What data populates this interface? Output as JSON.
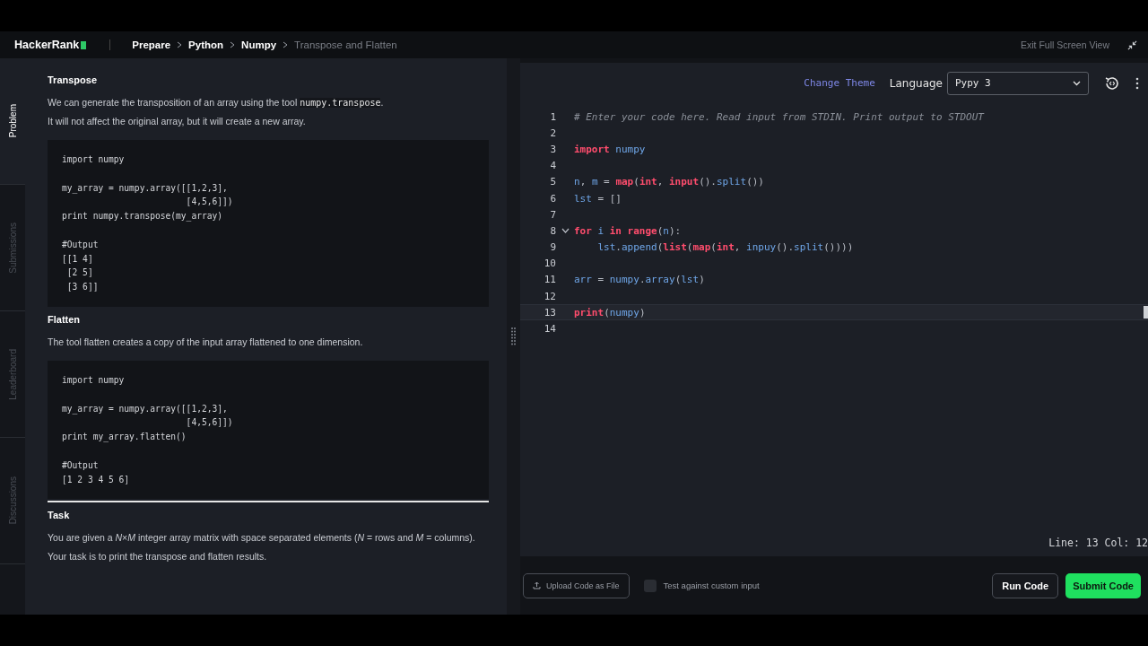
{
  "header": {
    "logo": "HackerRank",
    "breadcrumbs": [
      {
        "label": "Prepare",
        "current": false
      },
      {
        "label": "Python",
        "current": false
      },
      {
        "label": "Numpy",
        "current": false
      },
      {
        "label": "Transpose and Flatten",
        "current": true
      }
    ],
    "exit_label": "Exit Full Screen View"
  },
  "side_tabs": [
    {
      "label": "Problem",
      "selected": true
    },
    {
      "label": "Submissions",
      "selected": false
    },
    {
      "label": "Leaderboard",
      "selected": false
    },
    {
      "label": "Discussions",
      "selected": false
    }
  ],
  "problem": [
    {
      "kind": "heading",
      "text": "Transpose"
    },
    {
      "kind": "paragraph",
      "parts": [
        {
          "kind": "text",
          "text": "We can generate the transposition of an array using the tool "
        },
        {
          "kind": "code",
          "text": "numpy.transpose"
        },
        {
          "kind": "text",
          "text": "."
        }
      ]
    },
    {
      "kind": "paragraph",
      "parts": [
        {
          "kind": "text",
          "text": "It will not affect the original array, but it will create a new array."
        }
      ]
    },
    {
      "kind": "code",
      "text": "import numpy\n\nmy_array = numpy.array([[1,2,3],\n                        [4,5,6]])\nprint numpy.transpose(my_array)\n\n#Output\n[[1 4]\n [2 5]\n [3 6]]"
    },
    {
      "kind": "heading",
      "text": "Flatten"
    },
    {
      "kind": "paragraph",
      "parts": [
        {
          "kind": "text",
          "text": "The tool flatten creates a copy of the input array flattened to one dimension."
        }
      ]
    },
    {
      "kind": "code",
      "text": "import numpy\n\nmy_array = numpy.array([[1,2,3],\n                        [4,5,6]])\nprint my_array.flatten()\n\n#Output\n[1 2 3 4 5 6]"
    },
    {
      "kind": "rule"
    },
    {
      "kind": "heading",
      "text": "Task"
    },
    {
      "kind": "paragraph",
      "parts": [
        {
          "kind": "text",
          "text": "You are given a *N*×*M* integer array matrix with space separated elements (*N* = rows and *M* = columns)."
        }
      ]
    },
    {
      "kind": "paragraph",
      "parts": [
        {
          "kind": "text",
          "text": "Your task is to print the transpose and flatten results."
        }
      ]
    }
  ],
  "editor": {
    "change_theme": "Change Theme",
    "language_label": "Language",
    "language": "Pypy 3",
    "lines": [
      {
        "number": "1",
        "current": false,
        "tokens": [
          {
            "kind": "comment",
            "text": "# Enter your code here. Read input from STDIN. Print output to STDOUT"
          }
        ]
      },
      {
        "number": "2",
        "current": false
      },
      {
        "number": "3",
        "current": false,
        "tokens": [
          {
            "kind": "keyword",
            "text": "import"
          },
          {
            "kind": "name",
            "text": " numpy"
          }
        ]
      },
      {
        "number": "4",
        "current": false
      },
      {
        "number": "5",
        "current": false,
        "tokens": [
          {
            "kind": "name",
            "text": "n"
          },
          {
            "kind": "plain",
            "text": ", "
          },
          {
            "kind": "name",
            "text": "m"
          },
          {
            "kind": "plain",
            "text": " = "
          },
          {
            "kind": "keyword",
            "text": "map"
          },
          {
            "kind": "plain",
            "text": "("
          },
          {
            "kind": "keyword",
            "text": "int"
          },
          {
            "kind": "plain",
            "text": ", "
          },
          {
            "kind": "keyword",
            "text": "input"
          },
          {
            "kind": "plain",
            "text": "()."
          },
          {
            "kind": "name",
            "text": "split"
          },
          {
            "kind": "plain",
            "text": "())"
          }
        ]
      },
      {
        "number": "6",
        "current": false,
        "tokens": [
          {
            "kind": "name",
            "text": "lst"
          },
          {
            "kind": "plain",
            "text": " = []"
          }
        ]
      },
      {
        "number": "7",
        "current": false
      },
      {
        "number": "8",
        "current": false,
        "fold": true,
        "tokens": [
          {
            "kind": "keyword",
            "text": "for"
          },
          {
            "kind": "name",
            "text": " i "
          },
          {
            "kind": "keyword",
            "text": "in range"
          },
          {
            "kind": "plain",
            "text": "("
          },
          {
            "kind": "name",
            "text": "n"
          },
          {
            "kind": "plain",
            "text": "):"
          }
        ]
      },
      {
        "number": "9",
        "current": false,
        "tokens": [
          {
            "kind": "name",
            "text": "    lst"
          },
          {
            "kind": "plain",
            "text": "."
          },
          {
            "kind": "name",
            "text": "append"
          },
          {
            "kind": "plain",
            "text": "("
          },
          {
            "kind": "keyword",
            "text": "list"
          },
          {
            "kind": "plain",
            "text": "("
          },
          {
            "kind": "keyword",
            "text": "map"
          },
          {
            "kind": "plain",
            "text": "("
          },
          {
            "kind": "keyword",
            "text": "int"
          },
          {
            "kind": "plain",
            "text": ", "
          },
          {
            "kind": "name",
            "text": "inpuy"
          },
          {
            "kind": "plain",
            "text": "()."
          },
          {
            "kind": "name",
            "text": "split"
          },
          {
            "kind": "plain",
            "text": "())))"
          }
        ]
      },
      {
        "number": "10",
        "current": false
      },
      {
        "number": "11",
        "current": false,
        "tokens": [
          {
            "kind": "name",
            "text": "arr"
          },
          {
            "kind": "plain",
            "text": " = "
          },
          {
            "kind": "name",
            "text": "numpy"
          },
          {
            "kind": "plain",
            "text": "."
          },
          {
            "kind": "name",
            "text": "array"
          },
          {
            "kind": "plain",
            "text": "("
          },
          {
            "kind": "name",
            "text": "lst"
          },
          {
            "kind": "plain",
            "text": ")"
          }
        ]
      },
      {
        "number": "12",
        "current": false
      },
      {
        "number": "13",
        "current": true,
        "tokens": [
          {
            "kind": "keyword",
            "text": "print"
          },
          {
            "kind": "plain",
            "text": "("
          },
          {
            "kind": "name",
            "text": "numpy"
          },
          {
            "kind": "plain",
            "text": ")"
          }
        ]
      },
      {
        "number": "14",
        "current": false
      }
    ],
    "status": "Line: 13 Col: 12"
  },
  "footer": {
    "upload": "Upload Code as File",
    "custom_input": {
      "label": "Test against custom input",
      "checked": false
    },
    "run": "Run Code",
    "submit": "Submit Code"
  }
}
